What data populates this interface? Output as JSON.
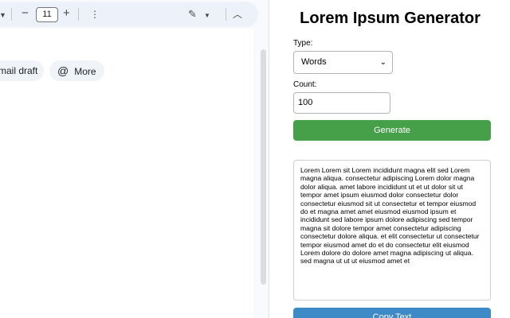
{
  "editor": {
    "toolbar": {
      "font_size": "11",
      "minus_label": "−",
      "plus_label": "+"
    },
    "chips": {
      "draft_label": "Email draft",
      "draft_visible_label": "mail draft",
      "more_label": "More"
    }
  },
  "generator": {
    "title": "Lorem Ipsum Generator",
    "type_label": "Type:",
    "type_selected": "Words",
    "count_label": "Count:",
    "count_value": "100",
    "generate_label": "Generate",
    "output_text": "Lorem Lorem sit Lorem incididunt magna elit sed Lorem magna aliqua. consectetur adipiscing Lorem dolor magna dolor aliqua. amet labore incididunt ut et ut dolor sit ut tempor amet ipsum eiusmod dolor consectetur dolor consectetur eiusmod sit ut consectetur et tempor eiusmod do et magna amet amet eiusmod eiusmod ipsum et incididunt sed labore ipsum dolore adipiscing sed tempor magna sit dolore tempor amet consectetur adipiscing consectetur dolore aliqua. et elit consectetur ut consectetur tempor eiusmod amet do et do consectetur elit eiusmod Lorem dolore do dolore amet magna adipiscing ut aliqua. sed magna ut ut ut eiusmod amet et",
    "copy_label": "Copy Text"
  },
  "icons": {
    "caret": "caret-down-icon",
    "more": "more-vert-icon",
    "pen": "pencil-edit-icon",
    "at": "at-sign-icon",
    "collapse": "chevron-up-icon",
    "select_chevron": "chevron-down-icon"
  },
  "colors": {
    "generate_button": "#46a049",
    "copy_button": "#3e8ac6",
    "toolbar_bg": "#edf2fa"
  }
}
